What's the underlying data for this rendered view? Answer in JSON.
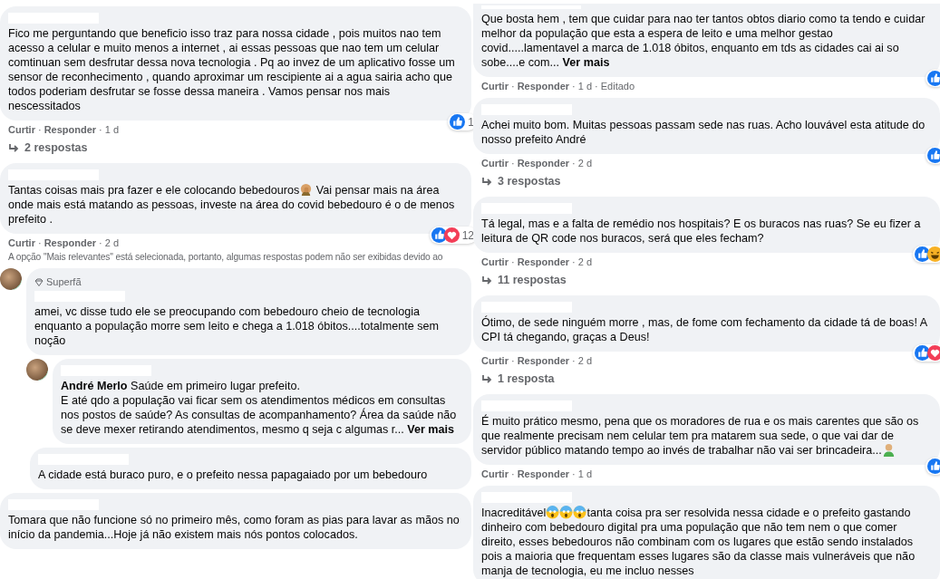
{
  "separator": "·",
  "columns": [
    {
      "items": [
        {
          "kind": "comment",
          "body": [
            {
              "kind": "text",
              "text": "Fico me perguntando que beneficio isso traz para nossa cidade , pois muitos nao tem acesso a celular e muito menos a internet , ai essas pessoas que nao tem um celular comtinuan sem desfrutar dessa nova tecnologia . Pq ao invez de um aplicativo fosse um sensor de reconhecimento , quando aproximar um rescipiente ai a agua sairia acho que todos poderiam desfrutar se fosse dessa maneira . Vamos pensar nos mais nescessitados"
            }
          ],
          "reactions": {
            "icons": [
              {
                "kind": "like"
              }
            ],
            "count": "1"
          },
          "actions": [
            {
              "kind": "link",
              "text": "Curtir"
            },
            {
              "kind": "link",
              "text": "Responder"
            },
            {
              "kind": "meta",
              "text": "1 d"
            }
          ]
        },
        {
          "kind": "replies",
          "text": "2 respostas"
        },
        {
          "kind": "comment",
          "body": [
            {
              "kind": "text",
              "text": "Tantas coisas mais pra fazer e ele colocando bebedouros"
            },
            {
              "kind": "facepalm"
            },
            {
              "kind": "text",
              "text": " Vai pensar mais na área onde mais está matando as pessoas, investe na área do covid bebedouro é o de menos prefeito ."
            }
          ],
          "reactions": {
            "icons": [
              {
                "kind": "like"
              },
              {
                "kind": "love"
              }
            ],
            "count": "12"
          },
          "actions": [
            {
              "kind": "link",
              "text": "Curtir"
            },
            {
              "kind": "link",
              "text": "Responder"
            },
            {
              "kind": "meta",
              "text": "2 d"
            }
          ],
          "children": [
            {
              "kind": "notice",
              "text": "A opção \"Mais relevantes\" está selecionada, portanto, algumas respostas podem não ser exibidas devido ao"
            },
            {
              "kind": "comment",
              "avatar": true,
              "badge": "Superfã",
              "body": [
                {
                  "kind": "text",
                  "text": "amei, vc disse tudo ele se preocupando com bebedouro cheio de tecnologia enquanto a população morre sem leito e chega a 1.018 óbitos....totalmente sem noção"
                }
              ],
              "children": [
                {
                  "kind": "comment",
                  "avatar": true,
                  "body": [
                    {
                      "kind": "text",
                      "text": "**André Merlo** Saúde em primeiro lugar prefeito.\nE até qdo a população vai ficar sem os atendimentos médicos em consultas nos postos de saúde? As consultas de acompanhamento? Área da saúde não se deve mexer retirando atendimentos, mesmo q seja c algumas r..."
                    }
                  ],
                  "more": "Ver mais"
                }
              ]
            },
            {
              "kind": "comment",
              "avatar": false,
              "body": [
                {
                  "kind": "text",
                  "text": "A cidade está buraco puro, e o prefeito nessa papagaiado por um bebedouro"
                }
              ]
            }
          ]
        },
        {
          "kind": "comment",
          "body": [
            {
              "kind": "text",
              "text": "Tomara que não funcione só no primeiro mês, como foram as pias para lavar as mãos no início da pandemia...Hoje já não existem mais nós pontos colocados."
            }
          ]
        }
      ]
    },
    {
      "items": [
        {
          "kind": "comment",
          "cut_top": true,
          "body": [
            {
              "kind": "text",
              "text": "Que bosta hem , tem que cuidar para nao ter tantos obtos diario como ta tendo e cuidar melhor da população que esta a espera de leito e uma melhor gestao covid.....lamentavel a marca de 1.018 óbitos, enquanto em tds as cidades cai ai so sobe....e com..."
            }
          ],
          "more": "Ver mais",
          "reactions": {
            "icons": [
              {
                "kind": "like"
              }
            ]
          },
          "actions": [
            {
              "kind": "link",
              "text": "Curtir"
            },
            {
              "kind": "link",
              "text": "Responder"
            },
            {
              "kind": "meta",
              "text": "1 d"
            },
            {
              "kind": "meta",
              "text": "Editado"
            }
          ]
        },
        {
          "kind": "comment",
          "body": [
            {
              "kind": "text",
              "text": "Achei muito bom. Muitas pessoas passam sede nas ruas. Acho louvável esta atitude do nosso prefeito André"
            }
          ],
          "reactions": {
            "icons": [
              {
                "kind": "like"
              }
            ]
          },
          "actions": [
            {
              "kind": "link",
              "text": "Curtir"
            },
            {
              "kind": "link",
              "text": "Responder"
            },
            {
              "kind": "meta",
              "text": "2 d"
            }
          ]
        },
        {
          "kind": "replies",
          "text": "3 respostas"
        },
        {
          "kind": "comment",
          "body": [
            {
              "kind": "text",
              "text": "Tá legal, mas e a falta de remédio nos hospitais? E os buracos nas ruas? Se eu fizer a leitura de QR code nos buracos, será que eles fecham?"
            }
          ],
          "reactions": {
            "icons": [
              {
                "kind": "like"
              },
              {
                "kind": "haha"
              }
            ]
          },
          "actions": [
            {
              "kind": "link",
              "text": "Curtir"
            },
            {
              "kind": "link",
              "text": "Responder"
            },
            {
              "kind": "meta",
              "text": "2 d"
            }
          ]
        },
        {
          "kind": "replies",
          "text": "11 respostas"
        },
        {
          "kind": "comment",
          "body": [
            {
              "kind": "text",
              "text": "Ótimo, de sede ninguém morre , mas, de fome com fechamento da cidade tá de boas! A CPI tá chegando, graças a Deus!"
            }
          ],
          "reactions": {
            "icons": [
              {
                "kind": "like"
              },
              {
                "kind": "love"
              }
            ]
          },
          "actions": [
            {
              "kind": "link",
              "text": "Curtir"
            },
            {
              "kind": "link",
              "text": "Responder"
            },
            {
              "kind": "meta",
              "text": "2 d"
            }
          ]
        },
        {
          "kind": "replies",
          "text": "1 resposta"
        },
        {
          "kind": "comment",
          "body": [
            {
              "kind": "text",
              "text": "É muito prático mesmo, pena que os moradores de rua e os mais carentes que são os que realmente precisam nem celular tem pra matarem sua sede, o que vai dar de servidor público matando tempo ao invés de trabalhar não vai ser brincadeira..."
            },
            {
              "kind": "person"
            }
          ],
          "reactions": {
            "icons": [
              {
                "kind": "like"
              }
            ]
          },
          "actions": [
            {
              "kind": "link",
              "text": "Curtir"
            },
            {
              "kind": "link",
              "text": "Responder"
            },
            {
              "kind": "meta",
              "text": "1 d"
            }
          ]
        },
        {
          "kind": "comment",
          "body": [
            {
              "kind": "text",
              "text": "Inacreditável"
            },
            {
              "kind": "scream"
            },
            {
              "kind": "scream"
            },
            {
              "kind": "scream"
            },
            {
              "kind": "text",
              "text": "tanta coisa pra ser resolvida nessa cidade e o prefeito gastando dinheiro com bebedouro digital pra uma população que não tem nem o que comer direito, esses bebedouros não combinam com os lugares que estão sendo instalados pois a maioria que frequentam esses lugares são da classe mais vulneráveis que não manja de tecnologia, eu me incluo nesses"
            }
          ]
        }
      ]
    }
  ]
}
